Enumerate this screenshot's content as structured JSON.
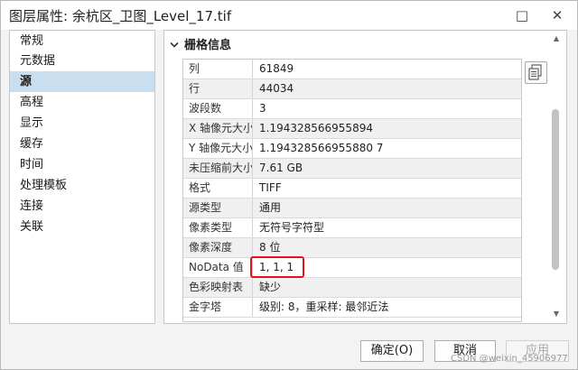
{
  "window": {
    "title": "图层属性: 余杭区_卫图_Level_17.tif",
    "minimize_glyph": "□",
    "close_glyph": "✕"
  },
  "nav": {
    "items": [
      {
        "label": "常规"
      },
      {
        "label": "元数据"
      },
      {
        "label": "源"
      },
      {
        "label": "高程"
      },
      {
        "label": "显示"
      },
      {
        "label": "缓存"
      },
      {
        "label": "时间"
      },
      {
        "label": "处理模板"
      },
      {
        "label": "连接"
      },
      {
        "label": "关联"
      }
    ],
    "selected": "源"
  },
  "section": {
    "title": "栅格信息",
    "chevron_icon": "chevron-down-icon"
  },
  "raster_info": {
    "columns": [
      "name",
      "value"
    ],
    "rows": [
      {
        "name": "列",
        "value": "61849"
      },
      {
        "name": "行",
        "value": "44034"
      },
      {
        "name": "波段数",
        "value": "3"
      },
      {
        "name": "X 轴像元大小",
        "value": "1.194328566955894"
      },
      {
        "name": "Y 轴像元大小",
        "value": "1.194328566955880 7"
      },
      {
        "name": "未压缩前大小",
        "value": "7.61 GB"
      },
      {
        "name": "格式",
        "value": "TIFF"
      },
      {
        "name": "源类型",
        "value": "通用"
      },
      {
        "name": "像素类型",
        "value": "无符号字符型"
      },
      {
        "name": "像素深度",
        "value": "8 位"
      },
      {
        "name": "NoData 值",
        "value": "1, 1, 1"
      },
      {
        "name": "色彩映射表",
        "value": "缺少"
      },
      {
        "name": "金字塔",
        "value": "级别: 8，重采样: 最邻近法"
      }
    ]
  },
  "copy_button": {
    "icon": "copy-icon"
  },
  "buttons": {
    "ok": "确定(O)",
    "cancel": "取消",
    "apply": "应用"
  },
  "watermark": "CSDN @weixin_45906977",
  "colors": {
    "selected_nav": "#c9dff0",
    "highlight_box": "#e0151b"
  }
}
